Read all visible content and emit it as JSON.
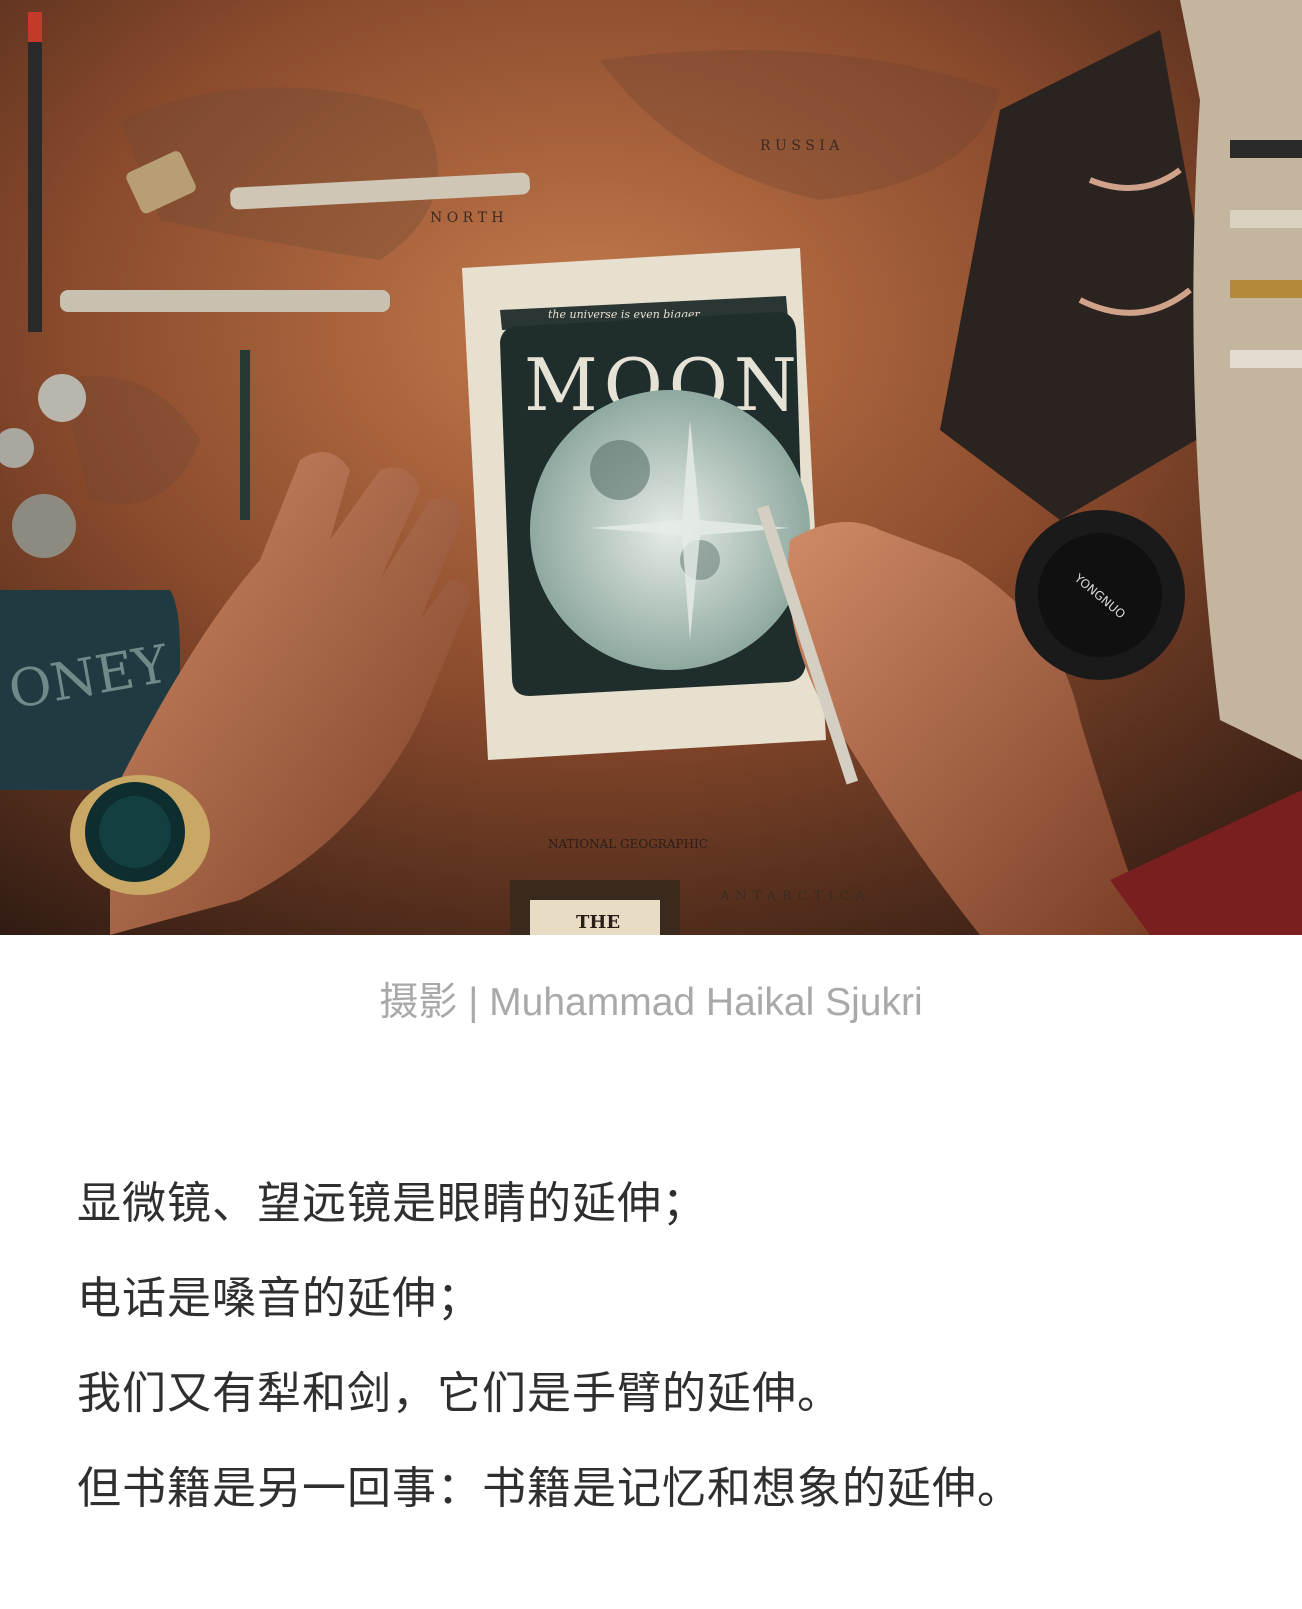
{
  "photo": {
    "subject": "hands-on-notebook-over-world-map",
    "notebook_banner": "the universe is even bigger",
    "notebook_title": "MOON",
    "map_logo": "NATIONAL GEOGRAPHIC",
    "map_label_bottom": "ANTARCTICA",
    "map_label_top": "N O R T H",
    "map_label_russia": "R U S S I A",
    "pouch_text": "ONEY",
    "frame_text": "THE",
    "lens_cap_text": "YONGNUO",
    "colors": {
      "map_warm": "#b06a45",
      "map_dark": "#3a2016",
      "notebook_page": "#e8e0cf",
      "notebook_ink": "#1f2e2c"
    }
  },
  "caption": "摄影 | Muhammad Haikal Sjukri",
  "paragraphs": [
    "显微镜、望远镜是眼睛的延伸；",
    "电话是嗓音的延伸；",
    "我们又有犁和剑，它们是手臂的延伸。",
    "但书籍是另一回事：书籍是记忆和想象的延伸。"
  ],
  "text_color": "#2f2f2f",
  "caption_color": "#a9a9a9"
}
